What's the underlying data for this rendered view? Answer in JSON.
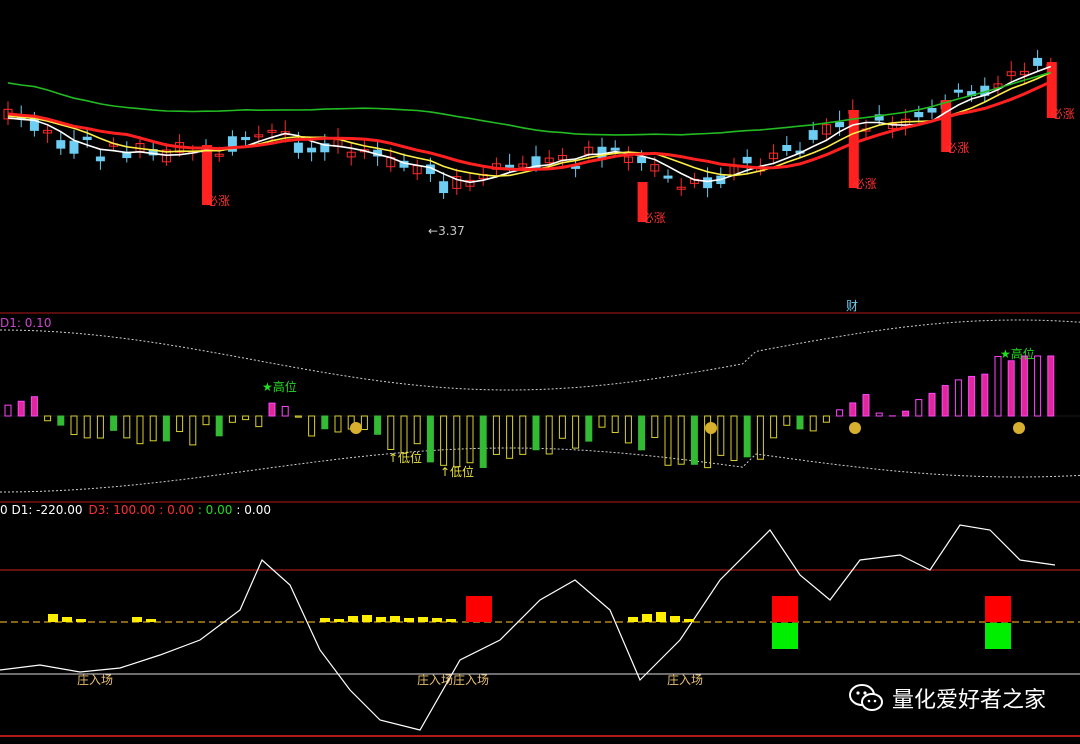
{
  "chart_data": [
    {
      "type": "candlestick",
      "panel": "main",
      "annotations": {
        "low_label": "3.37",
        "sure_rise_label": "必涨",
        "finance_marker": "财"
      },
      "ma_series": [
        {
          "color": "#ffffff"
        },
        {
          "color": "#ffee44"
        },
        {
          "color": "#ff2020"
        },
        {
          "color": "#22bb22"
        }
      ],
      "colors": {
        "up": "#ff2a2a",
        "down": "#6ecdf2",
        "flat": "#ffffff"
      }
    },
    {
      "type": "bar",
      "panel": "oscillator",
      "header": "D1: 0.10",
      "labels": {
        "high": "高位",
        "low": "低位"
      },
      "colors": {
        "positive": "#e0289a",
        "negative": "#d8d030",
        "outline": "#ff44ff"
      }
    },
    {
      "type": "line",
      "panel": "dealer",
      "header": {
        "d1": "D1: -220.00",
        "d3": "D3: 100.00",
        "v1": ": 0.00",
        "v2": ": 0.00",
        "v3": ": 0.00"
      },
      "labels": {
        "enter": "庄入场",
        "enter2": "庄入场"
      },
      "colors": {
        "line": "#ffffff",
        "signal_up": "#ff0000",
        "signal_down": "#00ee00",
        "bars": "#ffee00",
        "upper": "#cc2222",
        "mid": "#d8a020",
        "lower": "#dddddd"
      }
    }
  ],
  "watermark": {
    "text": "量化爱好者之家"
  }
}
